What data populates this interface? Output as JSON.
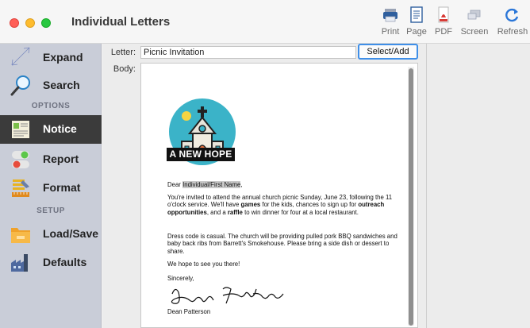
{
  "window": {
    "title": "Individual Letters"
  },
  "toolbar": {
    "buttons": [
      {
        "label": "Print",
        "icon": "printer-icon"
      },
      {
        "label": "Page",
        "icon": "page-icon"
      },
      {
        "label": "PDF",
        "icon": "pdf-icon"
      },
      {
        "label": "Screen",
        "icon": "screen-icon"
      },
      {
        "label": "Refresh",
        "icon": "refresh-icon"
      }
    ]
  },
  "sidebar": {
    "items": [
      {
        "label": "Expand",
        "icon": "expand-icon"
      },
      {
        "label": "Search",
        "icon": "search-icon"
      },
      {
        "label": "Notice",
        "icon": "notice-icon",
        "active": true
      },
      {
        "label": "Report",
        "icon": "toggle-icon"
      },
      {
        "label": "Format",
        "icon": "format-icon"
      },
      {
        "label": "Load/Save",
        "icon": "folder-icon"
      },
      {
        "label": "Defaults",
        "icon": "factory-icon"
      }
    ],
    "sections": {
      "options": "OPTIONS",
      "setup": "SETUP"
    }
  },
  "form": {
    "letter_label": "Letter:",
    "letter_value": "Picnic Invitation",
    "select_button": "Select/Add",
    "body_label": "Body:"
  },
  "letter": {
    "logo_text": "A NEW HOPE",
    "greeting_prefix": "Dear ",
    "greeting_field": "Individual/First Name",
    "greeting_suffix": ",",
    "p1_a": "You're invited to attend the annual church picnic Sunday, June 23, following the 11 o'clock service. We'll have ",
    "p1_games": "games",
    "p1_b": " for the kids, chances to sign up for ",
    "p1_outreach": "outreach opportunities",
    "p1_c": ", and a ",
    "p1_raffle": "raffle",
    "p1_d": " to win dinner for four at a local restaurant.",
    "p2": "Dress code is casual. The church will be providing pulled pork BBQ sandwiches and baby back ribs from Barrett's Smokehouse. Please bring a side dish or dessert to share.",
    "p3": "We hope to see you there!",
    "closing": "Sincerely,",
    "signer": "Dean Patterson"
  },
  "colors": {
    "sidebar_bg": "#c9cdd8",
    "active_bg": "#3b3b3b",
    "focus_ring": "#3f8fe8",
    "logo_circle": "#3bb3c8"
  }
}
